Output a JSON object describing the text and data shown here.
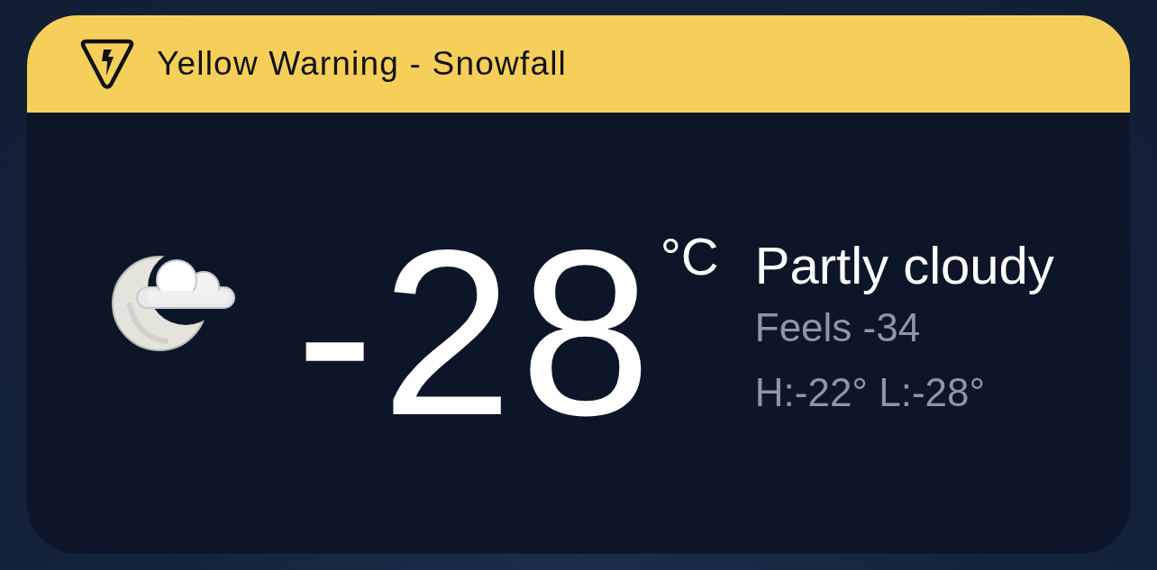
{
  "alert": {
    "title": "Yellow Warning - Snowfall"
  },
  "current": {
    "temperature": "-28",
    "unit": "°C",
    "condition": "Partly cloudy",
    "feels_like": "Feels -34",
    "high_low": "H:-22° L:-28°"
  }
}
